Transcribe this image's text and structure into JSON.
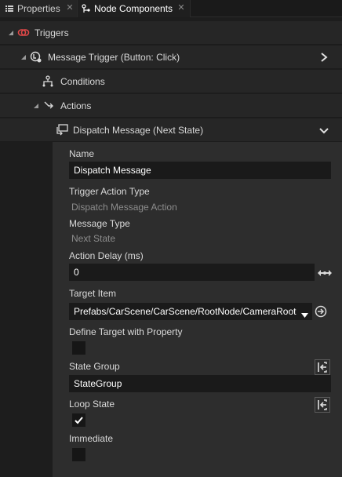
{
  "tabs": [
    {
      "label": "Properties",
      "icon": "properties-icon"
    },
    {
      "label": "Node Components",
      "icon": "node-components-icon"
    }
  ],
  "tree": {
    "triggers": "Triggers",
    "message_trigger": "Message Trigger (Button: Click)",
    "conditions": "Conditions",
    "actions": "Actions",
    "dispatch": "Dispatch Message (Next State)"
  },
  "panel": {
    "name_label": "Name",
    "name_value": "Dispatch Message",
    "trigger_action_type_label": "Trigger Action Type",
    "trigger_action_type_value": "Dispatch Message Action",
    "message_type_label": "Message Type",
    "message_type_value": "Next State",
    "action_delay_label": "Action Delay (ms)",
    "action_delay_value": "0",
    "target_item_label": "Target Item",
    "target_item_value": "Prefabs/CarScene/CarScene/RootNode/CameraRoot",
    "define_target_label": "Define Target with Property",
    "define_target_checked": false,
    "state_group_label": "State Group",
    "state_group_value": "StateGroup",
    "loop_state_label": "Loop State",
    "loop_state_checked": true,
    "immediate_label": "Immediate",
    "immediate_checked": false
  },
  "colors": {
    "background": "#1d1d1d",
    "row": "#262626",
    "panel": "#2d2d2d",
    "field": "#1a1a1a",
    "trigger_icon": "#e04848"
  }
}
